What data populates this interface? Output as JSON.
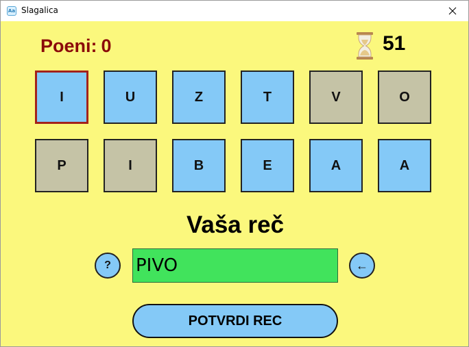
{
  "window": {
    "title": "Slagalica",
    "icon": "app-icon",
    "icon_text": "Aa"
  },
  "score": {
    "label": "Poeni:",
    "value": "0"
  },
  "timer": {
    "icon": "hourglass-icon",
    "value": "51"
  },
  "tiles": [
    {
      "letter": "I",
      "state": "selected"
    },
    {
      "letter": "U",
      "state": "available"
    },
    {
      "letter": "Z",
      "state": "available"
    },
    {
      "letter": "T",
      "state": "available"
    },
    {
      "letter": "V",
      "state": "used"
    },
    {
      "letter": "O",
      "state": "used"
    },
    {
      "letter": "P",
      "state": "used"
    },
    {
      "letter": "I",
      "state": "used"
    },
    {
      "letter": "B",
      "state": "available"
    },
    {
      "letter": "E",
      "state": "available"
    },
    {
      "letter": "A",
      "state": "available"
    },
    {
      "letter": "A",
      "state": "available"
    }
  ],
  "word_area": {
    "heading": "Vaša reč",
    "current_word": "PIVO",
    "help_label": "?",
    "backspace_label": "←"
  },
  "confirm_button": {
    "label": "POTVRDI REC"
  },
  "colors": {
    "background": "#fbf87d",
    "tile_available": "#84c9f7",
    "tile_used": "#c5c3a6",
    "tile_selected_border": "#a3221b",
    "word_field": "#41e35c",
    "score_text": "#8b0a0a"
  }
}
